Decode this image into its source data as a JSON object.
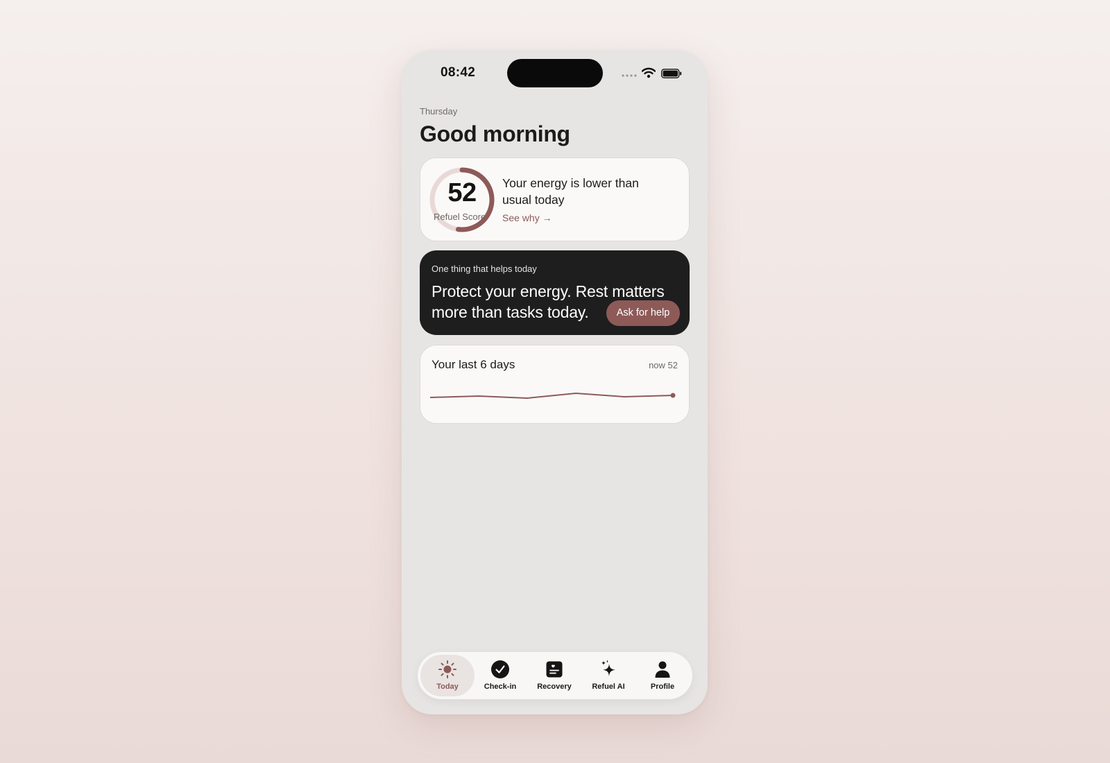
{
  "status_bar": {
    "time": "08:42"
  },
  "header": {
    "day": "Thursday",
    "title": "Good morning"
  },
  "score_card": {
    "score": "52",
    "score_fraction": 0.52,
    "score_label": "Refuel Score",
    "headline": "Your energy is lower than usual today",
    "link_label": "See why →"
  },
  "help_card": {
    "eyebrow": "One thing that helps today",
    "message": "Protect your energy. Rest matters more than tasks today.",
    "button_label": "Ask for help"
  },
  "trend_card": {
    "title": "Your last 6 days",
    "now_label": "now 52"
  },
  "tab_bar": {
    "tabs": [
      {
        "label": "Today",
        "icon": "sun-icon",
        "active": true
      },
      {
        "label": "Check-in",
        "icon": "check-circle-icon",
        "active": false
      },
      {
        "label": "Recovery",
        "icon": "journal-icon",
        "active": false
      },
      {
        "label": "Refuel AI",
        "icon": "sparkle-icon",
        "active": false
      },
      {
        "label": "Profile",
        "icon": "person-icon",
        "active": false
      }
    ]
  },
  "colors": {
    "accent": "#8d5a58",
    "ring_track": "#e8d9d7",
    "dark_card": "#1e1e1e",
    "screen_bg": "#e7e5e4"
  }
}
